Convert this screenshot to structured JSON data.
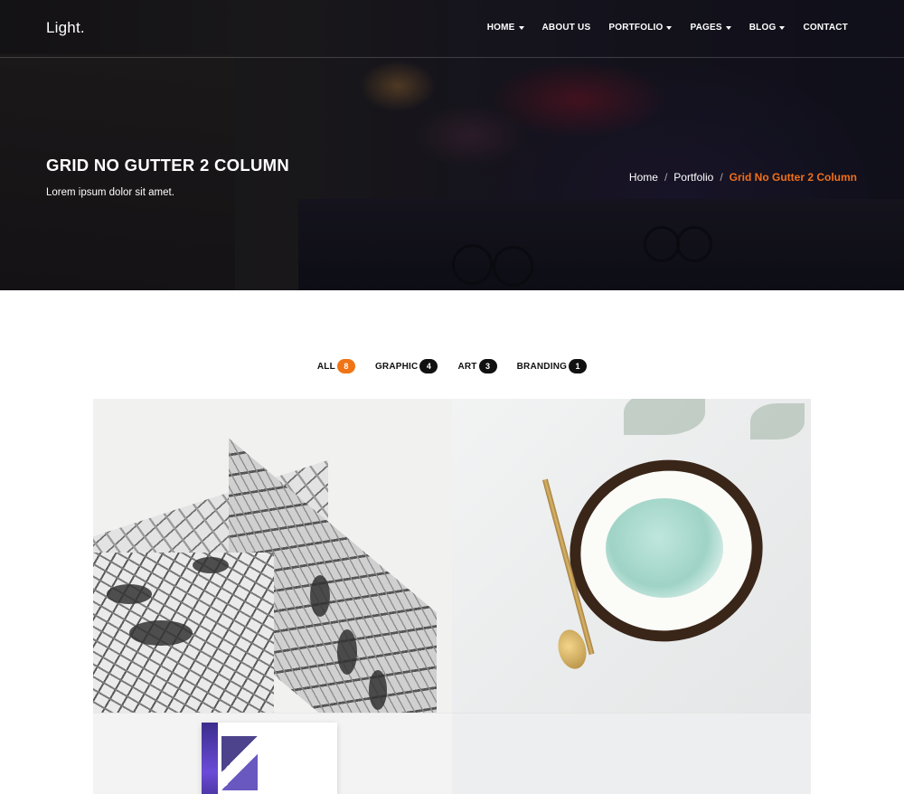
{
  "brand": {
    "logo": "Light."
  },
  "nav": {
    "items": [
      {
        "label": "HOME",
        "dropdown": true
      },
      {
        "label": "ABOUT US",
        "dropdown": false
      },
      {
        "label": "PORTFOLIO",
        "dropdown": true
      },
      {
        "label": "PAGES",
        "dropdown": true
      },
      {
        "label": "BLOG",
        "dropdown": true
      },
      {
        "label": "CONTACT",
        "dropdown": false
      }
    ]
  },
  "hero": {
    "title": "GRID NO GUTTER 2 COLUMN",
    "subtitle": "Lorem ipsum dolor sit amet.",
    "breadcrumb": [
      {
        "label": "Home"
      },
      {
        "label": "Portfolio"
      },
      {
        "label": "Grid No Gutter 2 Column"
      }
    ]
  },
  "filters": [
    {
      "label": "ALL",
      "count": "8",
      "active": true
    },
    {
      "label": "GRAPHIC",
      "count": "4",
      "active": false
    },
    {
      "label": "ART",
      "count": "3",
      "active": false
    },
    {
      "label": "BRANDING",
      "count": "1",
      "active": false
    }
  ],
  "colors": {
    "accent": "#f07416",
    "breadcrumb_active": "#f06f1a",
    "badge_dark": "#111111"
  }
}
